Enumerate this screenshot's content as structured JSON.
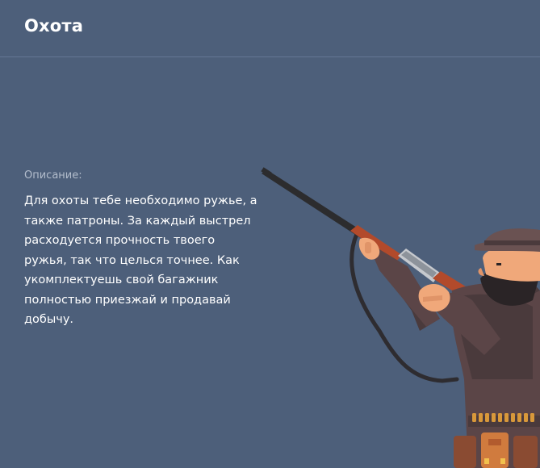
{
  "header": {
    "title": "Охота"
  },
  "description": {
    "label": "Описание:",
    "text": "Для охоты тебе необходимо ружье, а также патроны. За каждый выстрел расходуется прочность твоего ружья, так что целься точнее. Как укомплектуешь свой багажник полностью приезжай и продавай добычу."
  },
  "illustration": {
    "icon": "hunter-with-rifle-illustration"
  },
  "colors": {
    "background": "#4d5f7a",
    "title": "#ffffff",
    "label": "#b3bdcc",
    "divider": "#647694"
  }
}
